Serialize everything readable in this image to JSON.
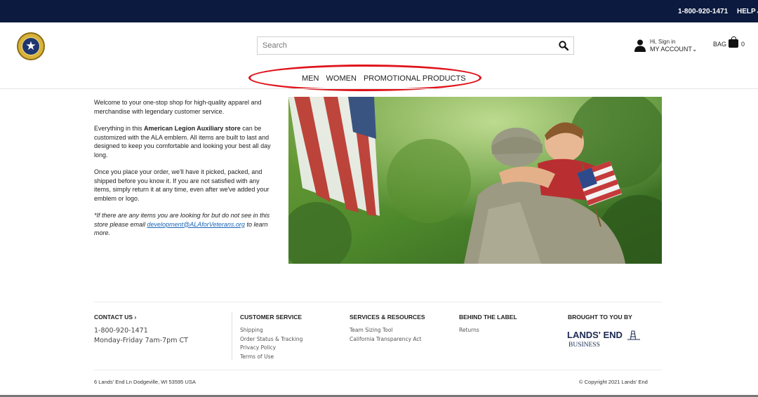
{
  "topbar": {
    "phone": "1-800-920-1471",
    "help": "HELP"
  },
  "header": {
    "logo_icon": "american-legion-auxiliary-emblem",
    "search": {
      "placeholder": "Search",
      "icon": "search-icon"
    },
    "account": {
      "greeting": "Hi, Sign in",
      "label": "MY ACCOUNT"
    },
    "bag": {
      "label": "BAG",
      "count": "0"
    }
  },
  "nav": {
    "items": [
      "MEN",
      "WOMEN",
      "PROMOTIONAL PRODUCTS"
    ]
  },
  "intro": {
    "p1": "Welcome to your one-stop shop for high-quality apparel and merchandise with legendary customer service.",
    "p2_pre": "Everything in this ",
    "p2_bold": "American Legion Auxiliary store",
    "p2_post": " can be customized with the ALA emblem.  All items are built to last and designed to keep you comfortable and looking your best all day long.",
    "p3": "Once you place your order, we'll have it picked, packed, and shipped before you know it.  If you are not satisfied with any items, simply return it at any time, even after we've added your emblem or logo.",
    "p4_pre": "*If there are any items you are looking for but do not see in this store please email ",
    "p4_link": "development@ALAforVeterans.org",
    "p4_post": " to learn more."
  },
  "footer": {
    "contact": {
      "heading": "CONTACT US",
      "phone": "1-800-920-1471",
      "hours": "Monday-Friday 7am-7pm CT"
    },
    "customer_service": {
      "heading": "CUSTOMER SERVICE",
      "links": [
        "Shipping",
        "Order Status & Tracking",
        "Privacy Policy",
        "Terms of Use"
      ]
    },
    "services": {
      "heading": "SERVICES & RESOURCES",
      "links": [
        "Team Sizing Tool",
        "California Transparency Act"
      ]
    },
    "behind": {
      "heading": "BEHIND THE LABEL",
      "links": [
        "Returns"
      ]
    },
    "brought": {
      "heading": "BROUGHT TO YOU BY",
      "brand": "LANDS' END",
      "sub": "BUSINESS"
    },
    "address": "6 Lands' End Ln Dodgeville, WI 53595 USA",
    "copyright": "© Copyright 2021 Lands' End"
  },
  "colors": {
    "topbar": "#0b1a3e",
    "highlight": "#e0131b",
    "link": "#1a66b8",
    "brand": "#1b2a52"
  }
}
